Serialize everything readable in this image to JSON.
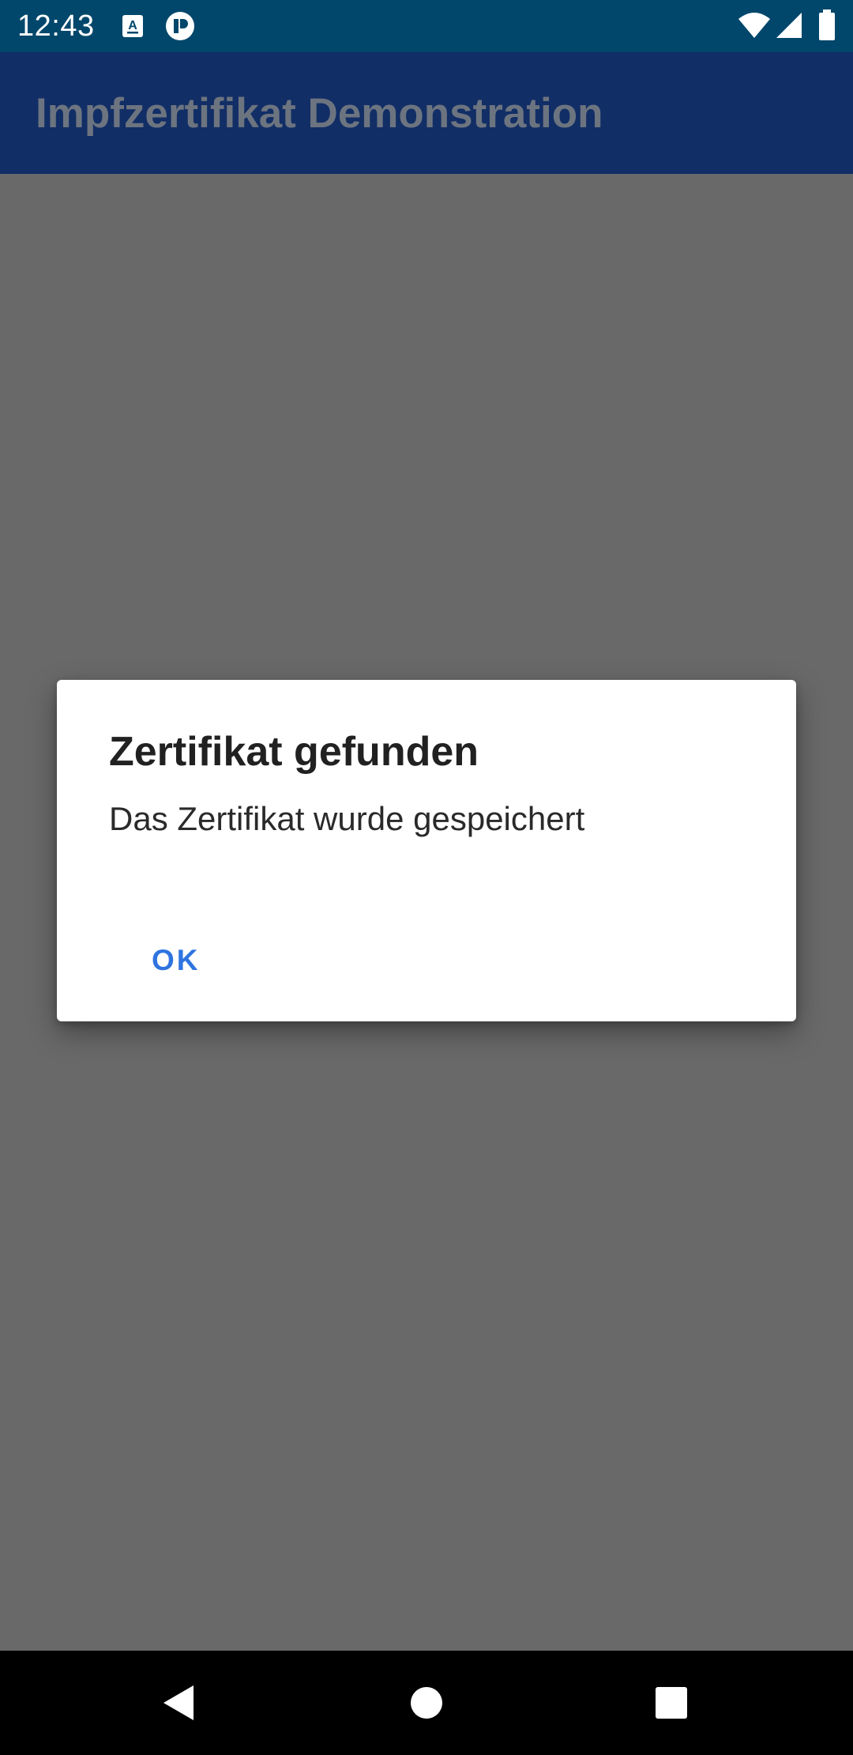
{
  "status_bar": {
    "time": "12:43",
    "left_icons": [
      "text-a-notification-icon",
      "cloud-notification-icon"
    ],
    "right_icons": [
      "wifi-icon",
      "cell-signal-icon",
      "battery-icon"
    ]
  },
  "app_bar": {
    "title": "Impfzertifikat Demonstration"
  },
  "dialog": {
    "title": "Zertifikat gefunden",
    "message": "Das Zertifikat wurde gespeichert",
    "ok_label": "OK"
  },
  "nav_bar": {
    "buttons": [
      "back-icon",
      "home-icon",
      "recents-icon"
    ]
  },
  "colors": {
    "status_bar": "#00476b",
    "app_bar": "#122e66",
    "scrim": "#696969",
    "dialog_bg": "#ffffff",
    "accent": "#2f74e0",
    "nav_bar": "#000000"
  }
}
